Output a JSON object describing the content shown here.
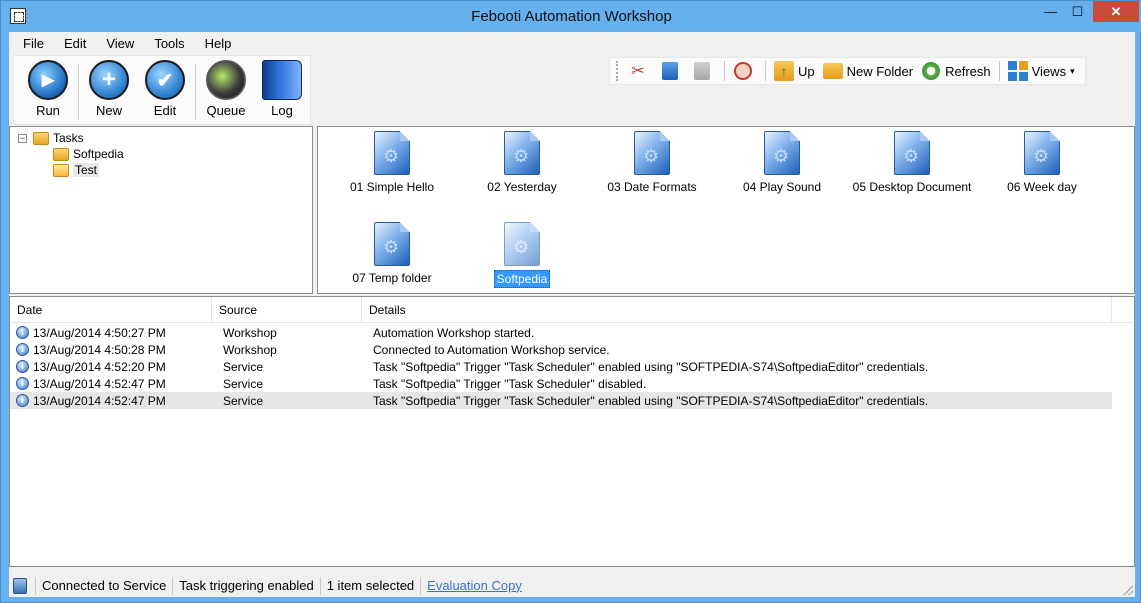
{
  "window": {
    "title": "Febooti Automation Workshop",
    "minimize": "—",
    "maximize": "☐",
    "close": "✕"
  },
  "menu": [
    "File",
    "Edit",
    "View",
    "Tools",
    "Help"
  ],
  "big_toolbar": {
    "run": "Run",
    "new": "New",
    "edit": "Edit",
    "queue": "Queue",
    "log": "Log"
  },
  "small_toolbar": {
    "cut_icon": "✂",
    "up": "Up",
    "new_folder": "New Folder",
    "refresh": "Refresh",
    "views": "Views",
    "views_arrow": "▾"
  },
  "tree": {
    "root": "Tasks",
    "root_expander": "−",
    "children": [
      "Softpedia",
      "Test"
    ]
  },
  "tasks": [
    "01 Simple Hello",
    "02 Yesterday",
    "03 Date Formats",
    "04 Play Sound",
    "05 Desktop Document",
    "06 Week day",
    "07 Temp folder",
    "Softpedia"
  ],
  "log": {
    "columns": [
      "Date",
      "Source",
      "Details"
    ],
    "info_glyph": "i",
    "rows": [
      {
        "date": "13/Aug/2014 4:50:27 PM",
        "source": "Workshop",
        "details": "Automation Workshop started."
      },
      {
        "date": "13/Aug/2014 4:50:28 PM",
        "source": "Workshop",
        "details": "Connected to Automation Workshop service."
      },
      {
        "date": "13/Aug/2014 4:52:20 PM",
        "source": "Service",
        "details": "Task \"Softpedia\" Trigger \"Task Scheduler\" enabled using \"SOFTPEDIA-S74\\SoftpediaEditor\" credentials."
      },
      {
        "date": "13/Aug/2014 4:52:47 PM",
        "source": "Service",
        "details": "Task \"Softpedia\" Trigger \"Task Scheduler\" disabled."
      },
      {
        "date": "13/Aug/2014 4:52:47 PM",
        "source": "Service",
        "details": "Task \"Softpedia\" Trigger \"Task Scheduler\" enabled using \"SOFTPEDIA-S74\\SoftpediaEditor\" credentials."
      }
    ]
  },
  "status": {
    "connection": "Connected to Service",
    "triggering": "Task triggering enabled",
    "selection": "1 item selected",
    "evaluation": "Evaluation Copy"
  },
  "colors": {
    "title_bar": "#66b0ee",
    "close_button": "#c74a3b",
    "selection": "#3399ff",
    "link": "#3a74c9"
  }
}
